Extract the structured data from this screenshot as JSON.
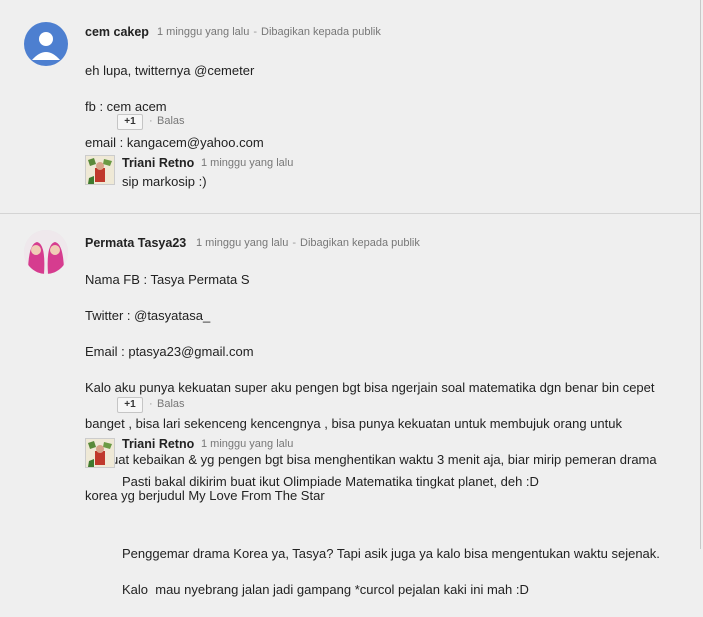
{
  "comments": [
    {
      "author": "cem cakep",
      "time": "1 minggu yang lalu",
      "sep": "-",
      "visibility": "Dibagikan kepada publik",
      "lines": [
        "eh lupa, twitternya @cemeter",
        "fb : cem acem",
        "email : kangacem@yahoo.com"
      ],
      "plus_label": "+1",
      "reply_sep": "·",
      "reply_label": "Balas",
      "reply": {
        "author": "Triani Retno",
        "time": "1 minggu yang lalu",
        "text": "sip markosip :)"
      }
    },
    {
      "author": "Permata Tasya23",
      "time": "1 minggu yang lalu",
      "sep": "-",
      "visibility": "Dibagikan kepada publik",
      "lines": [
        "Nama FB : Tasya Permata S",
        "Twitter : @tasyatasa_",
        "Email : ptasya23@gmail.com",
        "Kalo aku punya kekuatan super aku pengen bgt bisa ngerjain soal matematika dgn benar bin cepet",
        "banget , bisa lari sekenceng kencengnya , bisa punya kekuatan untuk membujuk orang untuk",
        "berbuat kebaikan & yg pengen bgt bisa menghentikan waktu 3 menit aja, biar mirip pemeran drama",
        "korea yg berjudul My Love From The Star"
      ],
      "plus_label": "+1",
      "reply_sep": "·",
      "reply_label": "Balas",
      "reply": {
        "author": "Triani Retno",
        "time": "1 minggu yang lalu",
        "text_lines": [
          "Pasti bakal dikirim buat ikut Olimpiade Matematika tingkat planet, deh :D",
          "Penggemar drama Korea ya, Tasya? Tapi asik juga ya kalo bisa mengentukan waktu sejenak.",
          "Kalo  mau nyebrang jalan jadi gampang *curcol pejalan kaki ini mah :D"
        ]
      }
    }
  ],
  "colors": {
    "background": "#efefef",
    "avatar_default": "#4d7fd0",
    "text": "#222222",
    "meta": "#777777"
  }
}
